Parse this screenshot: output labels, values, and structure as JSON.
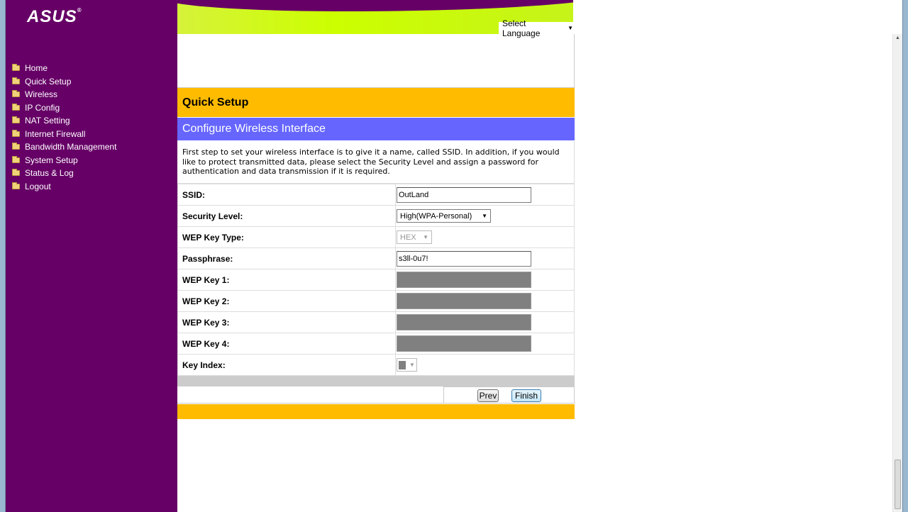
{
  "brand": {
    "logo_text": "ASUS",
    "trademark": "®"
  },
  "sidebar": {
    "items": [
      {
        "label": "Home",
        "icon": "folder-icon"
      },
      {
        "label": "Quick Setup",
        "icon": "folder-icon"
      },
      {
        "label": "Wireless",
        "icon": "folder-icon"
      },
      {
        "label": "IP Config",
        "icon": "folder-icon"
      },
      {
        "label": "NAT Setting",
        "icon": "folder-icon"
      },
      {
        "label": "Internet Firewall",
        "icon": "folder-icon"
      },
      {
        "label": "Bandwidth Management",
        "icon": "folder-icon"
      },
      {
        "label": "System Setup",
        "icon": "folder-icon"
      },
      {
        "label": "Status & Log",
        "icon": "folder-icon"
      },
      {
        "label": "Logout",
        "icon": "folder-icon"
      }
    ]
  },
  "header": {
    "language_select": "Select Language"
  },
  "main": {
    "title": "Quick Setup",
    "subtitle": "Configure Wireless Interface",
    "description": "First step to set your wireless interface is to give it a name, called SSID. In addition, if you would like to protect transmitted data, please select the Security Level and assign a password for authentication and data transmission if it is required.",
    "fields": {
      "ssid": {
        "label": "SSID:",
        "value": "OutLand"
      },
      "security_level": {
        "label": "Security Level:",
        "value": "High(WPA-Personal)"
      },
      "wep_key_type": {
        "label": "WEP Key Type:",
        "value": "HEX"
      },
      "passphrase": {
        "label": "Passphrase:",
        "value": "s3ll-0u7!"
      },
      "wep_key_1": {
        "label": "WEP Key 1:"
      },
      "wep_key_2": {
        "label": "WEP Key 2:"
      },
      "wep_key_3": {
        "label": "WEP Key 3:"
      },
      "wep_key_4": {
        "label": "WEP Key 4:"
      },
      "key_index": {
        "label": "Key Index:"
      }
    },
    "buttons": {
      "prev": "Prev",
      "finish": "Finish"
    }
  },
  "colors": {
    "sidebar_bg": "#660066",
    "banner_green": "#ccff00",
    "title_bar": "#ffbb00",
    "subtitle_bar": "#6666ff",
    "disabled_field": "#808080"
  }
}
